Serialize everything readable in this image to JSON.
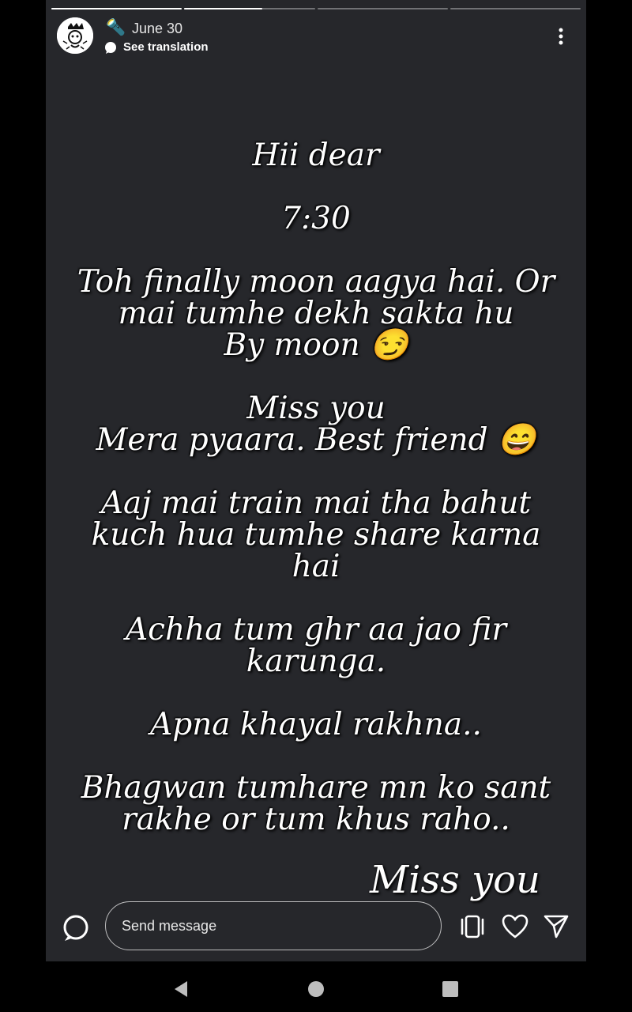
{
  "story": {
    "progress_fractions": [
      1,
      0.6,
      0,
      0
    ],
    "header": {
      "emoji": "🔦",
      "date": "June 30",
      "see_translation": "See translation"
    },
    "text_lines": [
      "Hii dear",
      "",
      "7:30",
      "",
      "Toh finally moon aagya hai. Or",
      "mai tumhe dekh sakta hu",
      "By moon 😏",
      "",
      "Miss you",
      "Mera pyaara. Best friend 😄",
      "",
      "Aaj mai train mai tha bahut",
      "kuch hua tumhe share karna",
      "hai",
      "",
      "Achha tum ghr aa jao fir",
      "karunga.",
      "",
      "Apna khayal rakhna..",
      "",
      "Bhagwan tumhare mn ko sant",
      "rakhe or tum khus raho.."
    ],
    "miss_you_big": "Miss you"
  },
  "bottom_bar": {
    "send_placeholder": "Send message",
    "icons": [
      "camera-icon",
      "reshare-icon",
      "heart-icon",
      "send-icon"
    ]
  },
  "navbar": {
    "icons": [
      "back-icon",
      "home-icon",
      "recents-icon"
    ]
  }
}
